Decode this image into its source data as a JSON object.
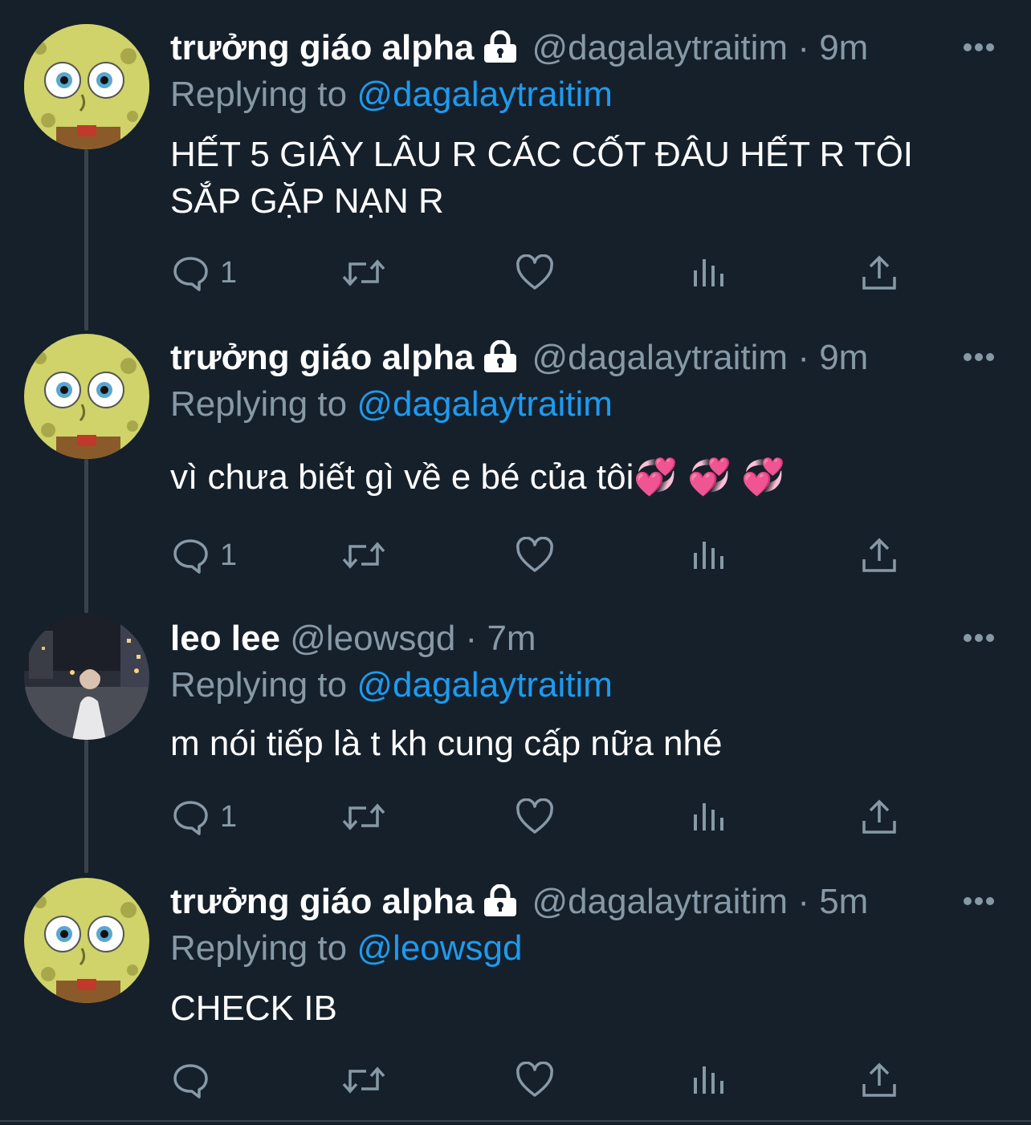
{
  "tweets": [
    {
      "name": "trưởng giáo alpha",
      "handle": "@dagalaytraitim",
      "time": "9m",
      "replying_label": "Replying to",
      "replying_to": "@dagalaytraitim",
      "text": "HẾT 5 GIÂY LÂU R CÁC CỐT ĐÂU HẾT R TÔI SẮP GẶP NẠN R",
      "reply_count": "1",
      "protected": true,
      "avatar": "spongebob-avatar"
    },
    {
      "name": "trưởng giáo alpha",
      "handle": "@dagalaytraitim",
      "time": "9m",
      "replying_label": "Replying to",
      "replying_to": "@dagalaytraitim",
      "text": "vì chưa biết gì về e bé của tôi💞 💞 💞",
      "reply_count": "1",
      "protected": true,
      "avatar": "spongebob-avatar"
    },
    {
      "name": "leo lee",
      "handle": "@leowsgd",
      "time": "7m",
      "replying_label": "Replying to",
      "replying_to": "@dagalaytraitim",
      "text": "m nói tiếp là t kh cung cấp nữa nhé",
      "reply_count": "1",
      "protected": false,
      "avatar": "photo-avatar"
    },
    {
      "name": "trưởng giáo alpha",
      "handle": "@dagalaytraitim",
      "time": "5m",
      "replying_label": "Replying to",
      "replying_to": "@leowsgd",
      "text": "CHECK IB",
      "reply_count": "",
      "protected": true,
      "avatar": "spongebob-avatar"
    }
  ],
  "separator": "·",
  "colors": {
    "background": "#15202b",
    "secondary_text": "#8899a6",
    "mention": "#1d9bf0",
    "thread_line": "#38444d"
  }
}
